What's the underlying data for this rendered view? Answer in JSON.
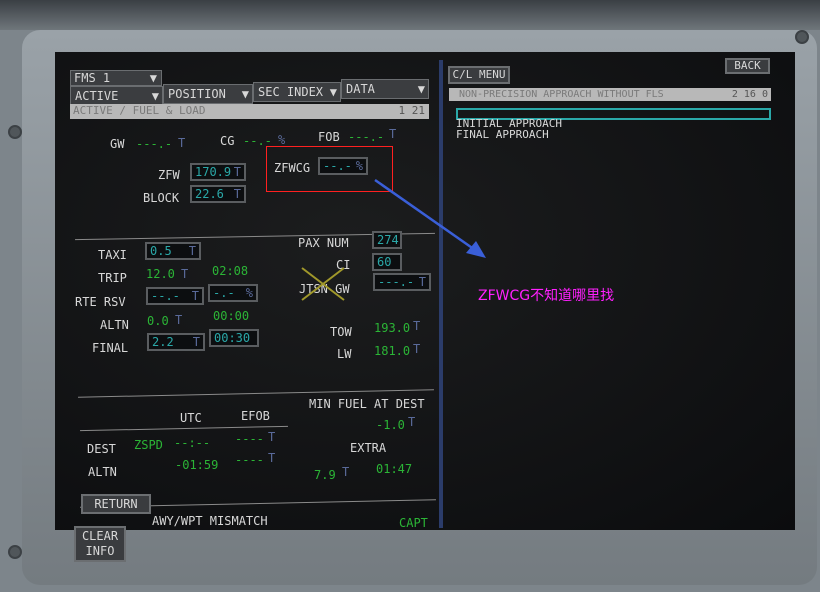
{
  "left": {
    "fms": "FMS 1",
    "menus": [
      "ACTIVE",
      "POSITION",
      "SEC INDEX",
      "DATA"
    ],
    "title": "ACTIVE / FUEL & LOAD",
    "page": "1 21",
    "gw_label": "GW",
    "gw_value": "---.-",
    "cg_label": "CG",
    "cg_value": "--.-",
    "fob_label": "FOB",
    "fob_value": "---.-",
    "zfw_label": "ZFW",
    "zfw_value": "170.9",
    "block_label": "BLOCK",
    "block_value": "22.6",
    "zfwcg_label": "ZFWCG",
    "zfwcg_value": "--.-",
    "taxi_label": "TAXI",
    "taxi_value": "0.5",
    "trip_label": "TRIP",
    "trip_value": "12.0",
    "trip_time": "02:08",
    "rte_rsv_label": "RTE RSV",
    "rte_rsv_value": "--.-",
    "rte_rsv_pct": "-.-",
    "altn_label": "ALTN",
    "altn_value": "0.0",
    "altn_time": "00:00",
    "final_label": "FINAL",
    "final_value": "2.2",
    "final_time": "00:30",
    "pax_label": "PAX NUM",
    "pax_value": "274",
    "ci_label": "CI",
    "ci_value": "60",
    "jtsn_label": "JTSN GW",
    "jtsn_value": "---.-",
    "tow_label": "TOW",
    "tow_value": "193.0",
    "lw_label": "LW",
    "lw_value": "181.0",
    "utc_header": "UTC",
    "efob_header": "EFOB",
    "dest_label": "DEST",
    "dest_airport": "ZSPD",
    "dest_utc": "--:--",
    "dest_efob": "----",
    "altn2_label": "ALTN",
    "altn2_utc": "-01:59",
    "altn2_efob": "----",
    "min_fuel_label": "MIN FUEL AT DEST",
    "min_fuel_value": "-1.0",
    "extra_label": "EXTRA",
    "extra_value": "7.9",
    "extra_time": "01:47",
    "unit_t": "T",
    "unit_pct": "%",
    "return_label": "RETURN",
    "message": "AWY/WPT MISMATCH",
    "clear_info": "CLEAR INFO",
    "capt": "CAPT"
  },
  "right": {
    "cl_menu": "C/L MENU",
    "back": "BACK",
    "title": "NON-PRECISION APPROACH WITHOUT FLS",
    "page": "2 16 0",
    "items": [
      "INITIAL APPROACH",
      "FINAL APPROACH"
    ]
  },
  "annotation": {
    "text": "ZFWCG不知道哪里找",
    "box_color": "#ff2020",
    "arrow_color": "#3a5fd8",
    "text_color": "#ff20ff"
  },
  "colors": {
    "green": "#2bb536",
    "cyan": "#2aa8a8",
    "white": "#d6d6d6"
  }
}
